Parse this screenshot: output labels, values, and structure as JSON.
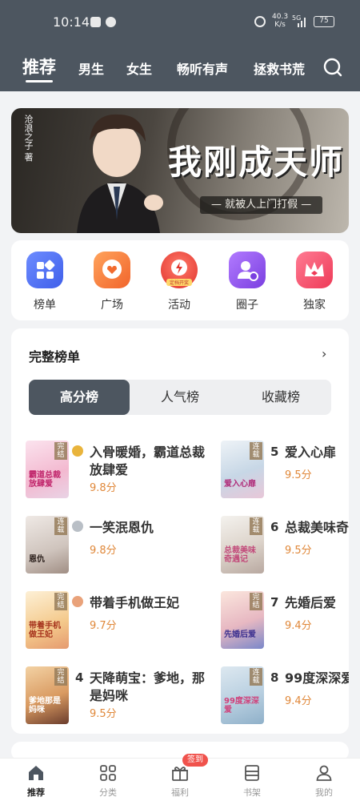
{
  "status_bar": {
    "time": "10:14",
    "speed": "40.3",
    "speed_unit": "K/s",
    "network": "5G",
    "battery": "75"
  },
  "top_tabs": [
    {
      "label": "推荐",
      "active": true
    },
    {
      "label": "男生",
      "active": false
    },
    {
      "label": "女生",
      "active": false
    },
    {
      "label": "畅听有声",
      "active": false
    },
    {
      "label": "拯救书荒",
      "active": false
    }
  ],
  "banner": {
    "author": "沧浪之子",
    "author_suffix": "著",
    "title": "我刚成天师",
    "subtitle": "— 就被人上门打假 —"
  },
  "quick_nav": [
    {
      "label": "榜单",
      "icon": "grid-icon",
      "color": "#4b6cf2"
    },
    {
      "label": "广场",
      "icon": "chat-heart-icon",
      "color": "#f26b2e"
    },
    {
      "label": "活动",
      "icon": "gift-clock-icon",
      "color": "#ef4a3f",
      "sub": "定档开奖"
    },
    {
      "label": "圈子",
      "icon": "user-circle-icon",
      "color": "#8a4be6"
    },
    {
      "label": "独家",
      "icon": "crown-icon",
      "color": "#f0435e"
    }
  ],
  "ranking": {
    "title": "完整榜单",
    "more": "›",
    "tabs": [
      {
        "label": "高分榜",
        "active": true
      },
      {
        "label": "人气榜",
        "active": false
      },
      {
        "label": "收藏榜",
        "active": false
      }
    ],
    "books": [
      {
        "rank": 1,
        "name": "入骨暖婚，霸道总裁放肆爱",
        "score": "9.8分",
        "tag": "完结",
        "cover_text": "霸道总裁放肆爱",
        "medal": "gold"
      },
      {
        "rank": 2,
        "name": "一笑泯恩仇",
        "score": "9.8分",
        "tag": "连载",
        "cover_text": "恩仇",
        "medal": "silver"
      },
      {
        "rank": 3,
        "name": "带着手机做王妃",
        "score": "9.7分",
        "tag": "完结",
        "cover_text": "带着手机做王妃",
        "medal": "bronze"
      },
      {
        "rank": 4,
        "name": "天降萌宝：爹地，那是妈咪",
        "score": "9.5分",
        "tag": "完结",
        "cover_text": "爹地那是妈咪"
      },
      {
        "rank": 5,
        "name": "爱入心扉",
        "score": "9.5分",
        "tag": "连载",
        "cover_text": "爱入心扉"
      },
      {
        "rank": 6,
        "name": "总裁美味奇",
        "score": "9.5分",
        "tag": "连载",
        "cover_text": "总裁美味奇遇记"
      },
      {
        "rank": 7,
        "name": "先婚后爱",
        "score": "9.4分",
        "tag": "完结",
        "cover_text": "先婚后爱"
      },
      {
        "rank": 8,
        "name": "99度深深爱",
        "score": "9.4分",
        "tag": "连载",
        "cover_text": "99度深深爱"
      }
    ]
  },
  "bottom_nav": [
    {
      "label": "推荐",
      "icon": "home-icon",
      "active": true
    },
    {
      "label": "分类",
      "icon": "category-icon",
      "active": false
    },
    {
      "label": "福利",
      "icon": "gift-icon",
      "active": false,
      "badge": "签到"
    },
    {
      "label": "书架",
      "icon": "bookshelf-icon",
      "active": false
    },
    {
      "label": "我的",
      "icon": "profile-icon",
      "active": false
    }
  ]
}
